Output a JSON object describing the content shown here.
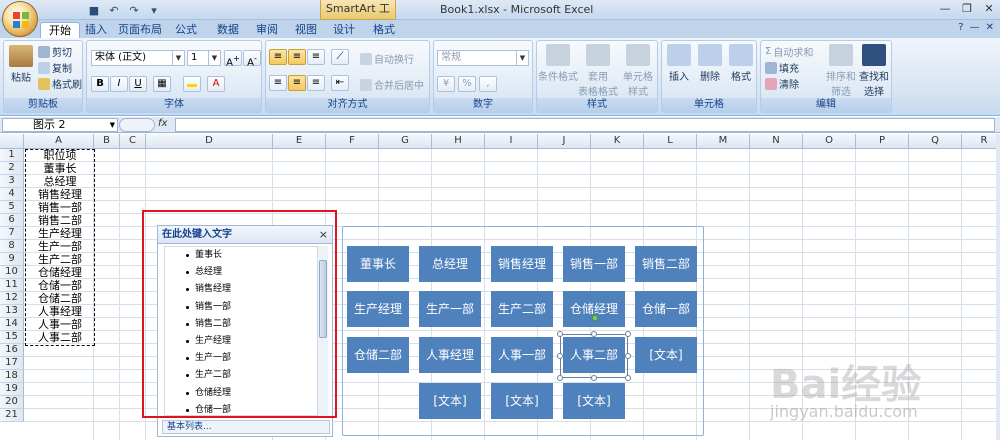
{
  "titlebar": {
    "tool_title": "SmartArt 工具",
    "doc_title": "Book1.xlsx - Microsoft Excel"
  },
  "tabs": [
    "开始",
    "插入",
    "页面布局",
    "公式",
    "数据",
    "审阅",
    "视图",
    "设计",
    "格式"
  ],
  "ribbon": {
    "clipboard": {
      "label": "剪贴板",
      "paste": "粘贴",
      "cut": "剪切",
      "copy": "复制",
      "format_painter": "格式刷"
    },
    "font": {
      "label": "字体",
      "font_name": "宋体 (正文)",
      "font_size": "1",
      "bold": "B",
      "italic": "I",
      "underline": "U"
    },
    "alignment": {
      "label": "对齐方式",
      "wrap_text": "自动换行",
      "merge_center": "合并后居中"
    },
    "number": {
      "label": "数字",
      "format": "常规"
    },
    "styles": {
      "label": "样式",
      "conditional": "条件格式",
      "table_format": "套用\n表格格式",
      "cell_style": "单元格\n样式"
    },
    "cells": {
      "label": "单元格",
      "insert": "插入",
      "delete": "删除",
      "format": "格式"
    },
    "editing": {
      "label": "编辑",
      "autosum": "自动求和",
      "fill": "填充",
      "clear": "清除",
      "sort_filter": "排序和\n筛选",
      "find_select": "查找和\n选择"
    }
  },
  "formula_bar": {
    "name_box": "图示 2",
    "fx": "fx"
  },
  "columns": [
    "A",
    "B",
    "C",
    "D",
    "E",
    "F",
    "G",
    "H",
    "I",
    "J",
    "K",
    "L",
    "M",
    "N",
    "O",
    "P",
    "Q",
    "R"
  ],
  "rows": [
    "1",
    "2",
    "3",
    "4",
    "5",
    "6",
    "7",
    "8",
    "9",
    "10",
    "11",
    "12",
    "13",
    "14",
    "15",
    "16",
    "17",
    "18",
    "19",
    "20",
    "21"
  ],
  "column_a": [
    "职位项",
    "董事长",
    "总经理",
    "销售经理",
    "销售一部",
    "销售二部",
    "生产经理",
    "生产一部",
    "生产二部",
    "仓储经理",
    "仓储一部",
    "仓储二部",
    "人事经理",
    "人事一部",
    "人事二部"
  ],
  "text_pane": {
    "title": "在此处键入文字",
    "close": "×",
    "items": [
      "董事长",
      "总经理",
      "销售经理",
      "销售一部",
      "销售二部",
      "生产经理",
      "生产一部",
      "生产二部",
      "仓储经理",
      "仓储一部"
    ],
    "footer": "基本列表..."
  },
  "smartart": {
    "rows": [
      [
        "董事长",
        "总经理",
        "销售经理",
        "销售一部",
        "销售二部"
      ],
      [
        "生产经理",
        "生产一部",
        "生产二部",
        "仓储经理",
        "仓储一部"
      ],
      [
        "仓储二部",
        "人事经理",
        "人事一部",
        "人事二部",
        "[文本]"
      ],
      [
        "[文本]",
        "[文本]",
        "[文本]"
      ]
    ]
  },
  "watermark": {
    "main": "Bai经验",
    "sub": "jingyan.baidu.com"
  }
}
